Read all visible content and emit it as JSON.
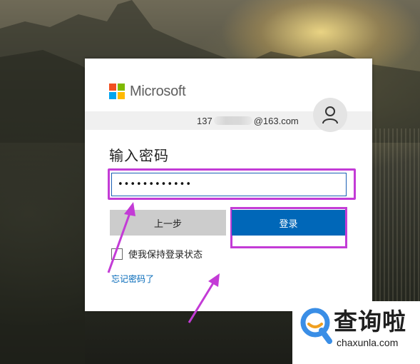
{
  "brand": {
    "name": "Microsoft",
    "logo_colors": [
      "#f25022",
      "#7fba00",
      "#00a4ef",
      "#ffb900"
    ]
  },
  "account": {
    "prefix": "137",
    "suffix": "@163.com",
    "avatar_icon": "user-icon"
  },
  "form": {
    "title": "输入密码",
    "password_value": "••••••••••••",
    "back_button": "上一步",
    "login_button": "登录",
    "keep_signed_in_label": "使我保持登录状态",
    "keep_signed_in_checked": false,
    "forgot_link": "忘记密码了"
  },
  "colors": {
    "accent": "#0067b8",
    "highlight": "#c33bd6"
  },
  "watermark": {
    "text_cn": "查询啦",
    "text_en": "chaxunla.com",
    "icon": "chaxunla-logo-icon",
    "color": "#3a8ee6"
  }
}
